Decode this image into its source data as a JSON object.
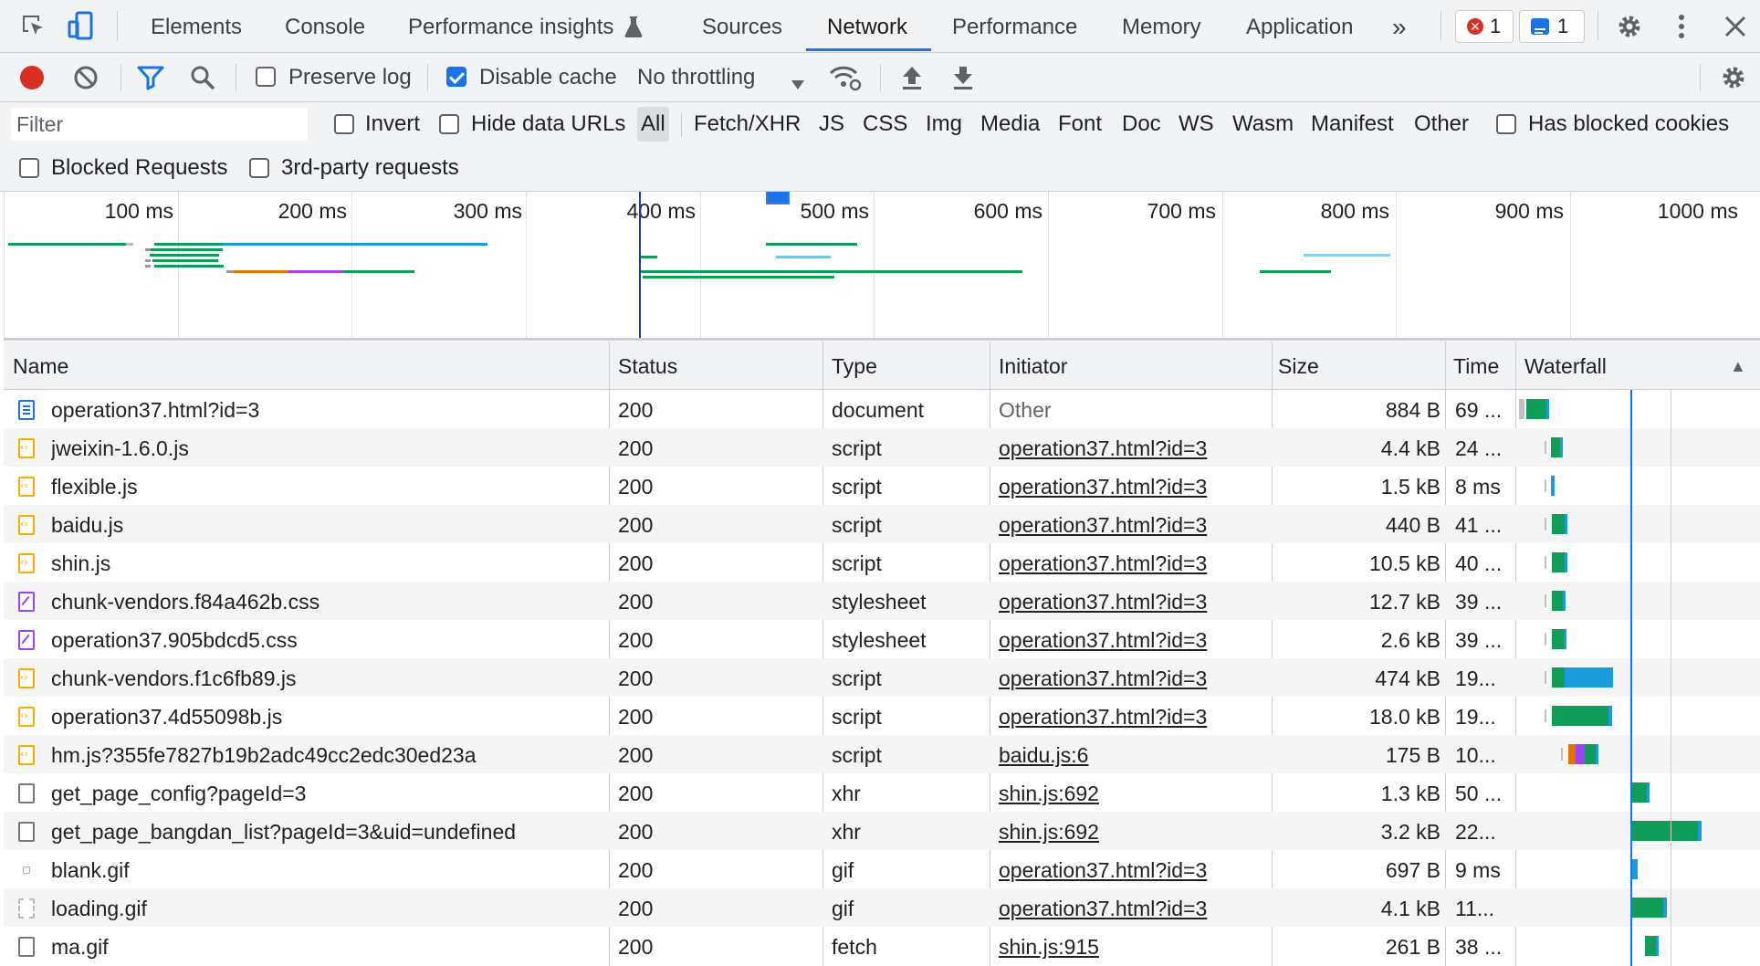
{
  "tabs": {
    "items": [
      "Elements",
      "Console",
      "Performance insights",
      "Sources",
      "Network",
      "Performance",
      "Memory",
      "Application"
    ],
    "more": "»",
    "error_count": "1",
    "message_count": "1"
  },
  "toolbar": {
    "preserve_log": "Preserve log",
    "disable_cache": "Disable cache",
    "throttling": "No throttling"
  },
  "filter": {
    "placeholder": "Filter",
    "invert": "Invert",
    "hide_data_urls": "Hide data URLs",
    "types": [
      "All",
      "Fetch/XHR",
      "JS",
      "CSS",
      "Img",
      "Media",
      "Font",
      "Doc",
      "WS",
      "Wasm",
      "Manifest",
      "Other"
    ],
    "has_blocked_cookies": "Has blocked cookies",
    "blocked_requests": "Blocked Requests",
    "third_party": "3rd-party requests"
  },
  "overview": {
    "labels": [
      "100 ms",
      "200 ms",
      "300 ms",
      "400 ms",
      "500 ms",
      "600 ms",
      "700 ms",
      "800 ms",
      "900 ms",
      "1000 ms"
    ]
  },
  "table": {
    "columns": {
      "name": "Name",
      "status": "Status",
      "type": "Type",
      "initiator": "Initiator",
      "size": "Size",
      "time": "Time",
      "waterfall": "Waterfall",
      "sort_icon": "▲"
    },
    "rows": [
      {
        "icon": "doc",
        "name": "operation37.html?id=3",
        "status": "200",
        "type": "document",
        "initiator": "Other",
        "initiator_link": false,
        "size": "884 B",
        "time": "69 ..."
      },
      {
        "icon": "script",
        "name": "jweixin-1.6.0.js",
        "status": "200",
        "type": "script",
        "initiator": "operation37.html?id=3",
        "initiator_link": true,
        "size": "4.4 kB",
        "time": "24 ..."
      },
      {
        "icon": "script",
        "name": "flexible.js",
        "status": "200",
        "type": "script",
        "initiator": "operation37.html?id=3",
        "initiator_link": true,
        "size": "1.5 kB",
        "time": "8 ms"
      },
      {
        "icon": "script",
        "name": "baidu.js",
        "status": "200",
        "type": "script",
        "initiator": "operation37.html?id=3",
        "initiator_link": true,
        "size": "440 B",
        "time": "41 ..."
      },
      {
        "icon": "script",
        "name": "shin.js",
        "status": "200",
        "type": "script",
        "initiator": "operation37.html?id=3",
        "initiator_link": true,
        "size": "10.5 kB",
        "time": "40 ..."
      },
      {
        "icon": "css",
        "name": "chunk-vendors.f84a462b.css",
        "status": "200",
        "type": "stylesheet",
        "initiator": "operation37.html?id=3",
        "initiator_link": true,
        "size": "12.7 kB",
        "time": "39 ..."
      },
      {
        "icon": "css",
        "name": "operation37.905bdcd5.css",
        "status": "200",
        "type": "stylesheet",
        "initiator": "operation37.html?id=3",
        "initiator_link": true,
        "size": "2.6 kB",
        "time": "39 ..."
      },
      {
        "icon": "script",
        "name": "chunk-vendors.f1c6fb89.js",
        "status": "200",
        "type": "script",
        "initiator": "operation37.html?id=3",
        "initiator_link": true,
        "size": "474 kB",
        "time": "19..."
      },
      {
        "icon": "script",
        "name": "operation37.4d55098b.js",
        "status": "200",
        "type": "script",
        "initiator": "operation37.html?id=3",
        "initiator_link": true,
        "size": "18.0 kB",
        "time": "19..."
      },
      {
        "icon": "script",
        "name": "hm.js?355fe7827b19b2adc49cc2edc30ed23a",
        "status": "200",
        "type": "script",
        "initiator": "baidu.js:6",
        "initiator_link": true,
        "size": "175 B",
        "time": "10..."
      },
      {
        "icon": "xhr",
        "name": "get_page_config?pageId=3",
        "status": "200",
        "type": "xhr",
        "initiator": "shin.js:692",
        "initiator_link": true,
        "size": "1.3 kB",
        "time": "50 ..."
      },
      {
        "icon": "xhr",
        "name": "get_page_bangdan_list?pageId=3&uid=undefined",
        "status": "200",
        "type": "xhr",
        "initiator": "shin.js:692",
        "initiator_link": true,
        "size": "3.2 kB",
        "time": "22..."
      },
      {
        "icon": "gif-small",
        "name": "blank.gif",
        "status": "200",
        "type": "gif",
        "initiator": "operation37.html?id=3",
        "initiator_link": true,
        "size": "697 B",
        "time": "9 ms"
      },
      {
        "icon": "gif",
        "name": "loading.gif",
        "status": "200",
        "type": "gif",
        "initiator": "operation37.html?id=3",
        "initiator_link": true,
        "size": "4.1 kB",
        "time": "11..."
      },
      {
        "icon": "xhr",
        "name": "ma.gif",
        "status": "200",
        "type": "fetch",
        "initiator": "shin.js:915",
        "initiator_link": true,
        "size": "261 B",
        "time": "38 ..."
      }
    ]
  },
  "colors": {
    "accent": "#1a73e8",
    "waiting": "#0f9d58",
    "download": "#1a9bdc",
    "record": "#d93025"
  }
}
